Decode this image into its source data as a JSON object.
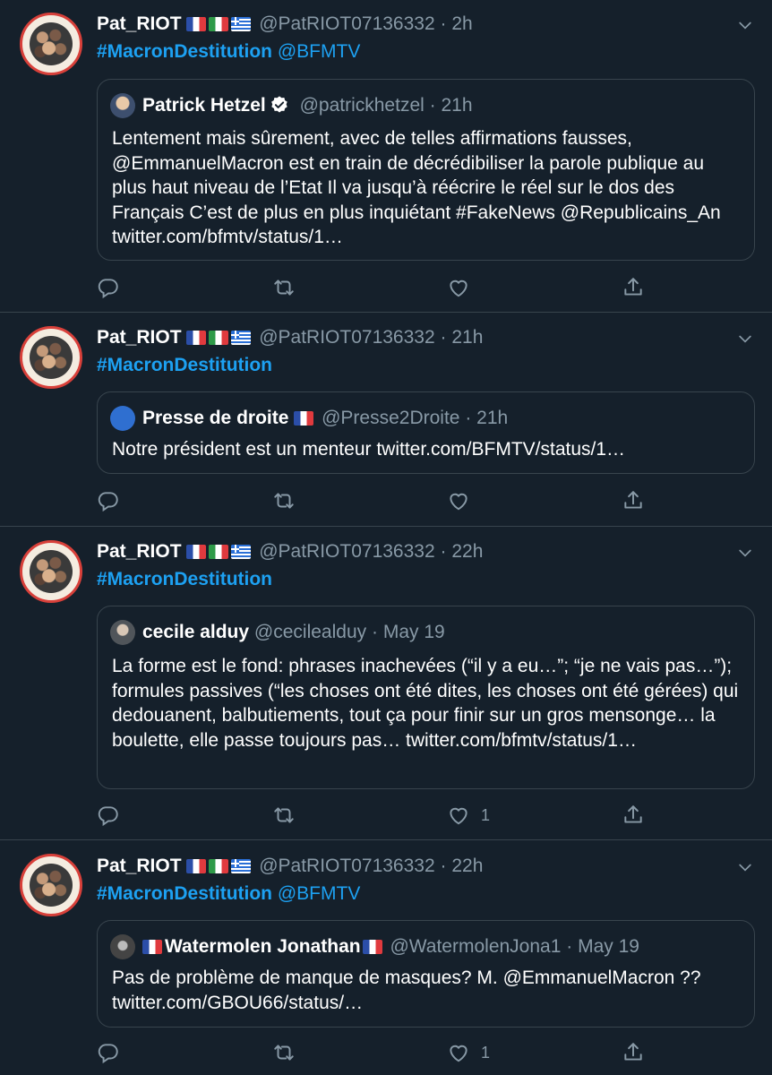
{
  "tweets": [
    {
      "user_name": "Pat_RIOT",
      "handle": "@PatRIOT07136332",
      "time": "2h",
      "hashtag": "#MacronDestitution",
      "mention": "@BFMTV",
      "quote": {
        "name": "Patrick Hetzel",
        "handle": "@patrickhetzel",
        "time": "21h",
        "text": "Lentement mais sûrement, avec de telles affirmations fausses, @EmmanuelMacron est en train de décrédibiliser la parole publique au plus haut niveau de l’Etat Il va jusqu’à réécrire le réel sur le dos des Français C’est de plus en plus inquiétant #FakeNews @Republicains_An twitter.com/bfmtv/status/1…"
      },
      "like_count": ""
    },
    {
      "user_name": "Pat_RIOT",
      "handle": "@PatRIOT07136332",
      "time": "21h",
      "hashtag": "#MacronDestitution",
      "mention": "",
      "quote": {
        "name": "Presse de droite",
        "handle": "@Presse2Droite",
        "time": "21h",
        "text": "Notre président est un menteur twitter.com/BFMTV/status/1…"
      },
      "like_count": ""
    },
    {
      "user_name": "Pat_RIOT",
      "handle": "@PatRIOT07136332",
      "time": "22h",
      "hashtag": "#MacronDestitution",
      "mention": "",
      "quote": {
        "name": "cecile alduy",
        "handle": "@cecilealduy",
        "time": "May 19",
        "text": "La forme est le fond: phrases inachevées (“il y a eu…”; “je ne vais pas…”); formules passives (“les choses ont été dites, les choses ont été gérées) qui dedouanent, balbutiements, tout ça pour finir  sur un gros mensonge… la boulette, elle passe toujours pas… twitter.com/bfmtv/status/1…"
      },
      "like_count": "1"
    },
    {
      "user_name": "Pat_RIOT",
      "handle": "@PatRIOT07136332",
      "time": "22h",
      "hashtag": "#MacronDestitution",
      "mention": "@BFMTV",
      "quote": {
        "name": "Watermolen Jonathan",
        "handle": "@WatermolenJona1",
        "time": "May 19",
        "text": "Pas de problème de manque de masques? M. @EmmanuelMacron ?? twitter.com/GBOU66/status/…"
      },
      "like_count": "1"
    }
  ],
  "separator": "·",
  "icons": [
    "reply-icon",
    "retweet-icon",
    "like-icon",
    "share-icon",
    "chevron-down-icon",
    "verified-icon"
  ],
  "colors": {
    "background": "#15202b",
    "accent": "#1da1f2",
    "muted": "#8899a6",
    "border": "#38444d"
  }
}
